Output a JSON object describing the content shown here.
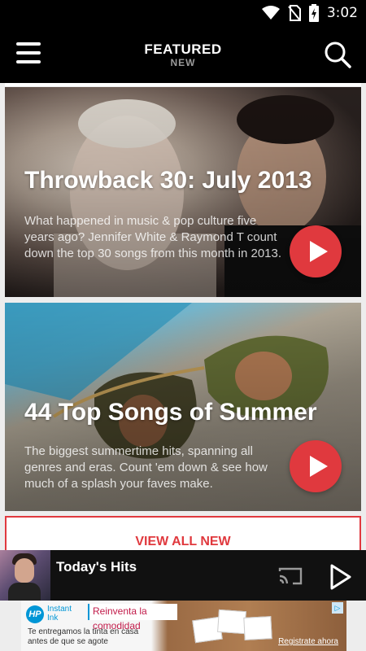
{
  "status_bar": {
    "time": "3:02",
    "icons": [
      "wifi-icon",
      "no-sim-icon",
      "battery-charging-icon"
    ]
  },
  "app_bar": {
    "title": "FEATURED",
    "subtitle": "NEW",
    "icons": [
      "menu-icon",
      "search-icon"
    ]
  },
  "cards": [
    {
      "title": "Throwback 30: July 2013",
      "description": "What happened in music & pop culture five years ago? Jennifer White & Raymond T count down the top 30 songs from this month in 2013."
    },
    {
      "title": "44 Top Songs of Summer",
      "description": "The biggest summertime hits, spanning all genres and eras. Count 'em down & see how much of a splash your faves make."
    }
  ],
  "view_all_label": "VIEW ALL NEW",
  "player": {
    "track": "Today's Hits",
    "icons": [
      "cast-icon",
      "play-icon"
    ]
  },
  "ad": {
    "brand_line1": "HP",
    "brand_line2": "Instant",
    "brand_line3": "Ink",
    "slogan": "Reinventa la comodidad",
    "copy": "Te entregamos la tinta en casa antes de que se agote",
    "cta": "Registrate ahora"
  },
  "colors": {
    "accent": "#e0393e",
    "app_bar_bg": "#000000",
    "player_bg": "#111111"
  }
}
